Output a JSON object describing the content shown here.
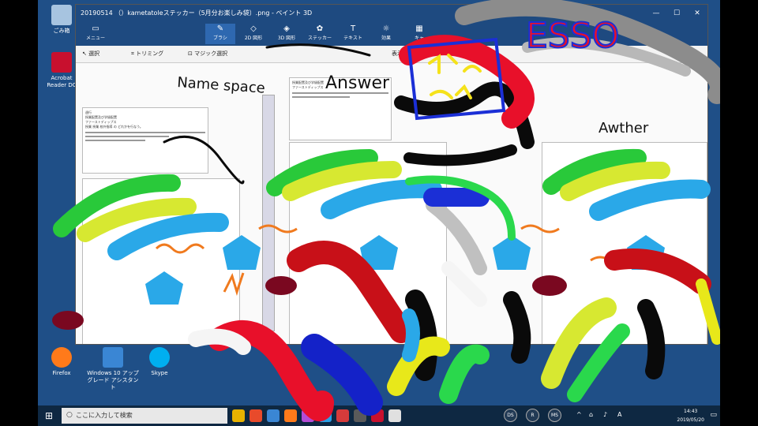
{
  "desktop": {
    "icons": [
      {
        "label": "ごみ箱",
        "color": "#a7c4e0"
      },
      {
        "label": "Acrobat Reader DC",
        "color": "#c8102e"
      },
      {
        "label": "Firefox",
        "color": "#ff7a1a"
      },
      {
        "label": "Windows 10 アップグレード アシスタント",
        "color": "#3a86d4"
      },
      {
        "label": "Skype",
        "color": "#00aff0"
      }
    ]
  },
  "paint": {
    "title": "20190514 （）kametatoleステッカー（5月分お楽しみ袋）.png - ペイント 3D",
    "menu_label": "メニュー",
    "tools": [
      {
        "label": "ブラシ",
        "icon": "brush-icon",
        "glyph": "✎",
        "active": true
      },
      {
        "label": "2D 図形",
        "icon": "shapes-2d-icon",
        "glyph": "◇"
      },
      {
        "label": "3D 図形",
        "icon": "shapes-3d-icon",
        "glyph": "◈"
      },
      {
        "label": "ステッカー",
        "icon": "sticker-icon",
        "glyph": "✿"
      },
      {
        "label": "テキスト",
        "icon": "text-icon",
        "glyph": "T"
      },
      {
        "label": "効果",
        "icon": "effects-icon",
        "glyph": "☼"
      },
      {
        "label": "キャ",
        "icon": "canvas-icon",
        "glyph": "▦"
      }
    ],
    "subbar": {
      "select": "選択",
      "crop": "トリミング",
      "magic_select": "マジック選択",
      "display": "表示"
    },
    "window_controls": {
      "minimize": "—",
      "maximize": "☐",
      "close": "✕"
    }
  },
  "doc_text": {
    "line1": "週行",
    "line2": "授業配置及び学級配置",
    "line3": "ファーストディップス",
    "line4": "授業 授業 校外指導 の どれかを行なう。"
  },
  "handwriting": {
    "name_space": "Name space",
    "answer": "Answer",
    "author": "Awther",
    "esso": "ESSO"
  },
  "taskbar": {
    "search_placeholder": "ここに入力して検索",
    "pinned": [
      "#e8b200",
      "#e84a2b",
      "#3a86d4",
      "#ff7a1a",
      "#b44cd6",
      "#2aa0e6",
      "#d63b3b",
      "#5a5a5a",
      "#c8102e",
      "#e0e0e0"
    ],
    "user_buttons": [
      "DS",
      "R",
      "MS"
    ],
    "tray_symbols": [
      "^",
      "⌂",
      "♪",
      "A"
    ],
    "time": "14:43",
    "date": "2019/05/20"
  }
}
